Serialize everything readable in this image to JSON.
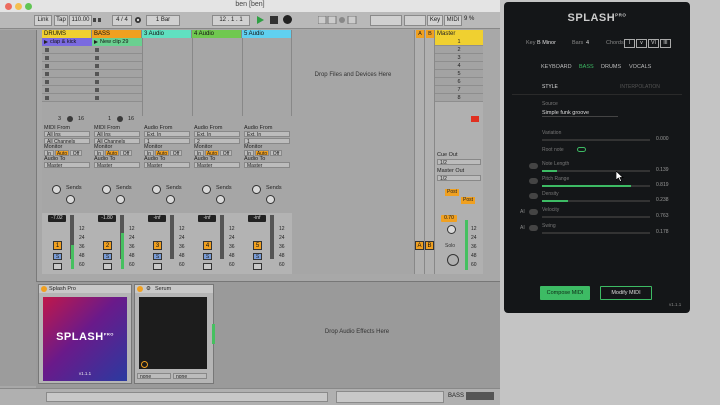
{
  "ableton": {
    "window_title": "ben  [ben]",
    "transport": {
      "link": "Link",
      "tap": "Tap",
      "tempo": "110.00",
      "time_sig": "4 / 4",
      "quant": "1 Bar",
      "position": "12 . 1 . 1",
      "key": "Key",
      "midi": "MIDI",
      "cpu": "9 %"
    },
    "tracks": [
      {
        "name": "DRUMS",
        "color": "#f0d030",
        "clip": "clap & kick",
        "clip_color": "#7a6ae0",
        "num": "1",
        "vol": "-7.02",
        "input_type": "All Ins",
        "input_channel": "All Channels",
        "out": "Master"
      },
      {
        "name": "BASS",
        "color": "#f0a020",
        "clip": "New clip 29",
        "clip_color": "#6ad090",
        "num": "2",
        "vol": "-1.80",
        "input_type": "All Ins",
        "input_channel": "All Channels",
        "out": "Master"
      },
      {
        "name": "3 Audio",
        "color": "#60e0c0",
        "clip": "",
        "clip_color": "",
        "num": "3",
        "vol": "-inf",
        "input_type": "Ext. In",
        "input_channel": "1",
        "out": "Master"
      },
      {
        "name": "4 Audio",
        "color": "#70c850",
        "clip": "",
        "clip_color": "",
        "num": "4",
        "vol": "-inf",
        "input_type": "Ext. In",
        "input_channel": "2",
        "out": "Master"
      },
      {
        "name": "5 Audio",
        "color": "#60d0f0",
        "clip": "",
        "clip_color": "",
        "num": "5",
        "vol": "-inf",
        "input_type": "Ext. In",
        "input_channel": "1",
        "out": "Master"
      }
    ],
    "labels": {
      "midi_from": "MIDI From",
      "audio_from": "Audio From",
      "monitor": "Monitor",
      "audio_to": "Audio To",
      "mon_in": "In",
      "mon_auto": "Auto",
      "mon_off": "Off",
      "sends": "Sends",
      "drop_files": "Drop Files and Devices Here",
      "drop_effects": "Drop Audio Effects Here",
      "cue_out": "Cue Out",
      "cue_out_val": "1/2",
      "master_out": "Master Out",
      "master_out_val": "1/2",
      "post": "Post",
      "solo": "Solo",
      "master_vol": "0.70",
      "track_a": "A",
      "track_b": "B",
      "selected_track": "BASS"
    },
    "drum_counts": [
      "3",
      "16"
    ],
    "bass_counts": [
      "1",
      "16"
    ],
    "meter_scale": [
      "12",
      "24",
      "36",
      "48",
      "60"
    ],
    "master": {
      "name": "Master",
      "scenes": [
        "1",
        "2",
        "3",
        "4",
        "5",
        "6",
        "7",
        "8"
      ]
    },
    "device_splash": {
      "name": "Splash Pro",
      "logo": "SPLASH",
      "logo_sup": "PRO",
      "version": "v1.1.1"
    },
    "device_serum": {
      "name": "Serum",
      "none1": "none",
      "none2": "none"
    }
  },
  "splash": {
    "logo": "SPLASH",
    "logo_sup": "PRO",
    "key_label": "Key",
    "key_value": "B Minor",
    "bars_label": "Bars",
    "bars_value": "4",
    "chords_label": "Chords",
    "chords": [
      "I",
      "v",
      "VI",
      "III"
    ],
    "tabs": [
      "KEYBOARD",
      "BASS",
      "DRUMS",
      "VOCALS"
    ],
    "active_tab": "BASS",
    "subtabs": [
      "STYLE",
      "INTERPOLATION"
    ],
    "source_label": "Source",
    "source_value": "Simple funk groove",
    "params": [
      {
        "name": "Variation",
        "value": "0.000",
        "fill": 0.0,
        "toggle": false
      },
      {
        "name": "Root note",
        "value": "",
        "fill": 0.0,
        "toggle": false
      },
      {
        "name": "Note Length",
        "value": "0.139",
        "fill": 0.14,
        "toggle": true
      },
      {
        "name": "Pitch Range",
        "value": "0.819",
        "fill": 0.82,
        "toggle": true
      },
      {
        "name": "Density",
        "value": "0.238",
        "fill": 0.24,
        "toggle": true
      },
      {
        "name": "Velocity",
        "value": "0.763",
        "fill": 0.76,
        "toggle": true,
        "ai": "AI"
      },
      {
        "name": "Swing",
        "value": "0.178",
        "fill": 0.18,
        "toggle": true,
        "ai": "AI"
      }
    ],
    "compose_button": "Compose MIDI",
    "modify_button": "Modify MIDI",
    "version": "v1.1.1",
    "accent": "#3dbb64"
  }
}
